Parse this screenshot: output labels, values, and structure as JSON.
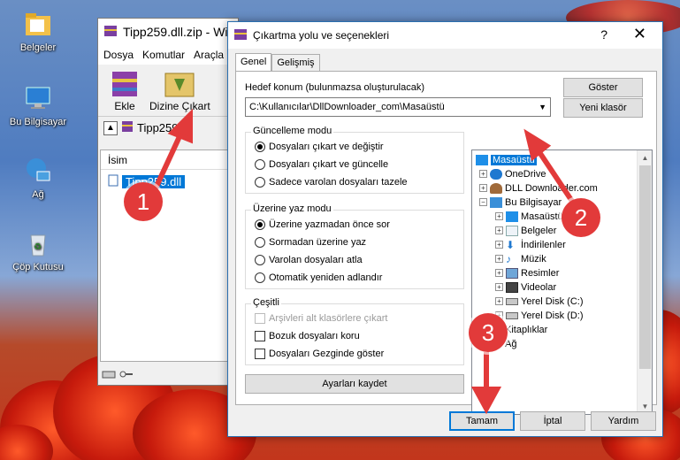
{
  "desktop": {
    "icons": [
      {
        "label": "Belgeler"
      },
      {
        "label": "Bu Bilgisayar"
      },
      {
        "label": "Ağ"
      },
      {
        "label": "Çöp Kutusu"
      }
    ]
  },
  "winrar": {
    "title": "Tipp259.dll.zip - Wi",
    "menu": [
      "Dosya",
      "Komutlar",
      "Araçla"
    ],
    "toolbar": {
      "add_label": "Ekle",
      "extract_label": "Dizine Çıkart"
    },
    "address": "Tipp259.dll",
    "column_name": "İsim",
    "file": "Tipp259.dll"
  },
  "dialog": {
    "title": "Çıkartma yolu ve seçenekleri",
    "help_glyph": "?",
    "close_glyph": "✕",
    "tabs": [
      "Genel",
      "Gelişmiş"
    ],
    "destination_label": "Hedef konum (bulunmazsa oluşturulacak)",
    "destination_value": "C:\\Kullanıcılar\\DllDownloader_com\\Masaüstü",
    "show_button": "Göster",
    "new_folder_button": "Yeni klasör",
    "update_mode": {
      "title": "Güncelleme modu",
      "options": [
        "Dosyaları çıkart ve değiştir",
        "Dosyaları çıkart ve güncelle",
        "Sadece varolan dosyaları tazele"
      ],
      "selected": 0
    },
    "overwrite_mode": {
      "title": "Üzerine yaz modu",
      "options": [
        "Üzerine yazmadan önce sor",
        "Sormadan üzerine yaz",
        "Varolan dosyaları atla",
        "Otomatik yeniden adlandır"
      ],
      "selected": 0
    },
    "misc": {
      "title": "Çeşitli",
      "options": [
        "Arşivleri alt klasörlere çıkart",
        "Bozuk dosyaları koru",
        "Dosyaları Gezginde göster"
      ]
    },
    "save_settings_button": "Ayarları kaydet",
    "tree": [
      {
        "label": "Masaüstü",
        "level": 0,
        "selected": true
      },
      {
        "label": "OneDrive",
        "level": 1
      },
      {
        "label": "DLL Downloader.com",
        "level": 1
      },
      {
        "label": "Bu Bilgisayar",
        "level": 1
      },
      {
        "label": "Masaüstü",
        "level": 2
      },
      {
        "label": "Belgeler",
        "level": 2
      },
      {
        "label": "İndirilenler",
        "level": 2
      },
      {
        "label": "Müzik",
        "level": 2
      },
      {
        "label": "Resimler",
        "level": 2
      },
      {
        "label": "Videolar",
        "level": 2
      },
      {
        "label": "Yerel Disk (C:)",
        "level": 2
      },
      {
        "label": "Yerel Disk (D:)",
        "level": 2
      },
      {
        "label": "Kitaplıklar",
        "level": 1
      },
      {
        "label": "Ağ",
        "level": 1
      }
    ],
    "ok_button": "Tamam",
    "cancel_button": "İptal",
    "help_button": "Yardım"
  },
  "annotations": [
    "1",
    "2",
    "3"
  ],
  "colors": {
    "annotation": "#e23a3a",
    "selection": "#0078d7"
  }
}
